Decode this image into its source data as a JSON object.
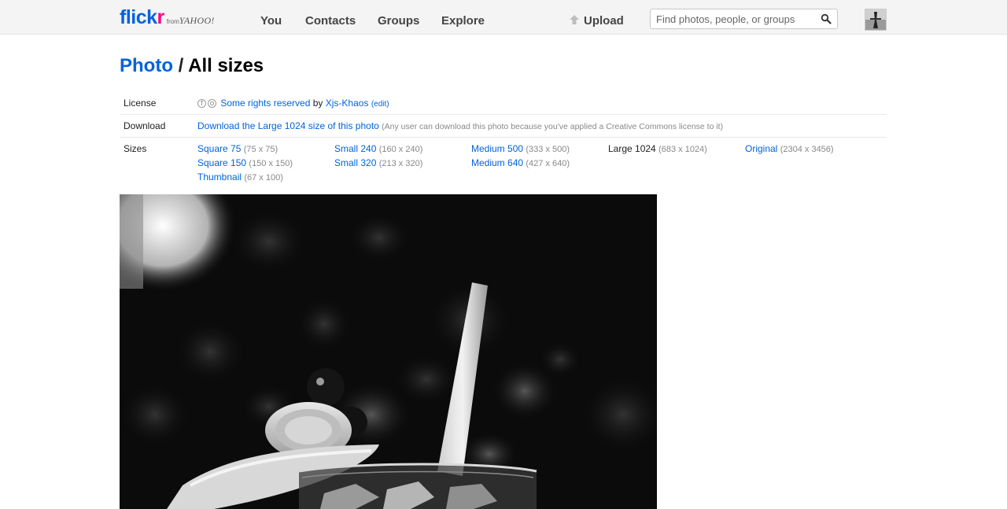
{
  "header": {
    "logo": {
      "flick": "flick",
      "r": "r",
      "from": "from",
      "yahoo": "YAHOO!"
    },
    "nav": [
      "You",
      "Contacts",
      "Groups",
      "Explore"
    ],
    "upload_label": "Upload",
    "search": {
      "placeholder": "Find photos, people, or groups",
      "value": ""
    }
  },
  "page": {
    "breadcrumb": "Photo",
    "separator": " / ",
    "title": "All sizes"
  },
  "license": {
    "label": "License",
    "icons": [
      "cc-by-icon",
      "cc-nc-icon"
    ],
    "link_text": "Some rights reserved",
    "by_text": "by",
    "author": "Xjs-Khaos",
    "edit_text": "(edit)"
  },
  "download": {
    "label": "Download",
    "link_text": "Download the Large 1024 size of this photo",
    "note": "(Any user can download this photo because you've applied a Creative Commons license to it)"
  },
  "sizes": {
    "label": "Sizes",
    "columns": [
      [
        {
          "name": "Square 75",
          "dims": "(75 x 75)",
          "link": true
        },
        {
          "name": "Square 150",
          "dims": "(150 x 150)",
          "link": true
        },
        {
          "name": "Thumbnail",
          "dims": "(67 x 100)",
          "link": true
        }
      ],
      [
        {
          "name": "Small 240",
          "dims": "(160 x 240)",
          "link": true
        },
        {
          "name": "Small 320",
          "dims": "(213 x 320)",
          "link": true
        }
      ],
      [
        {
          "name": "Medium 500",
          "dims": "(333 x 500)",
          "link": true
        },
        {
          "name": "Medium 640",
          "dims": "(427 x 640)",
          "link": true
        }
      ],
      [
        {
          "name": "Large 1024",
          "dims": "(683 x 1024)",
          "link": false
        }
      ],
      [
        {
          "name": "Original",
          "dims": "(2304 x 3456)",
          "link": true
        }
      ]
    ]
  },
  "colors": {
    "link": "#0063dc",
    "brand_pink": "#ff0084",
    "text": "#212124",
    "muted": "#888888"
  },
  "photo": {
    "subject": "black-and-white cocktail glass with straw, lemon slice and cherry"
  }
}
